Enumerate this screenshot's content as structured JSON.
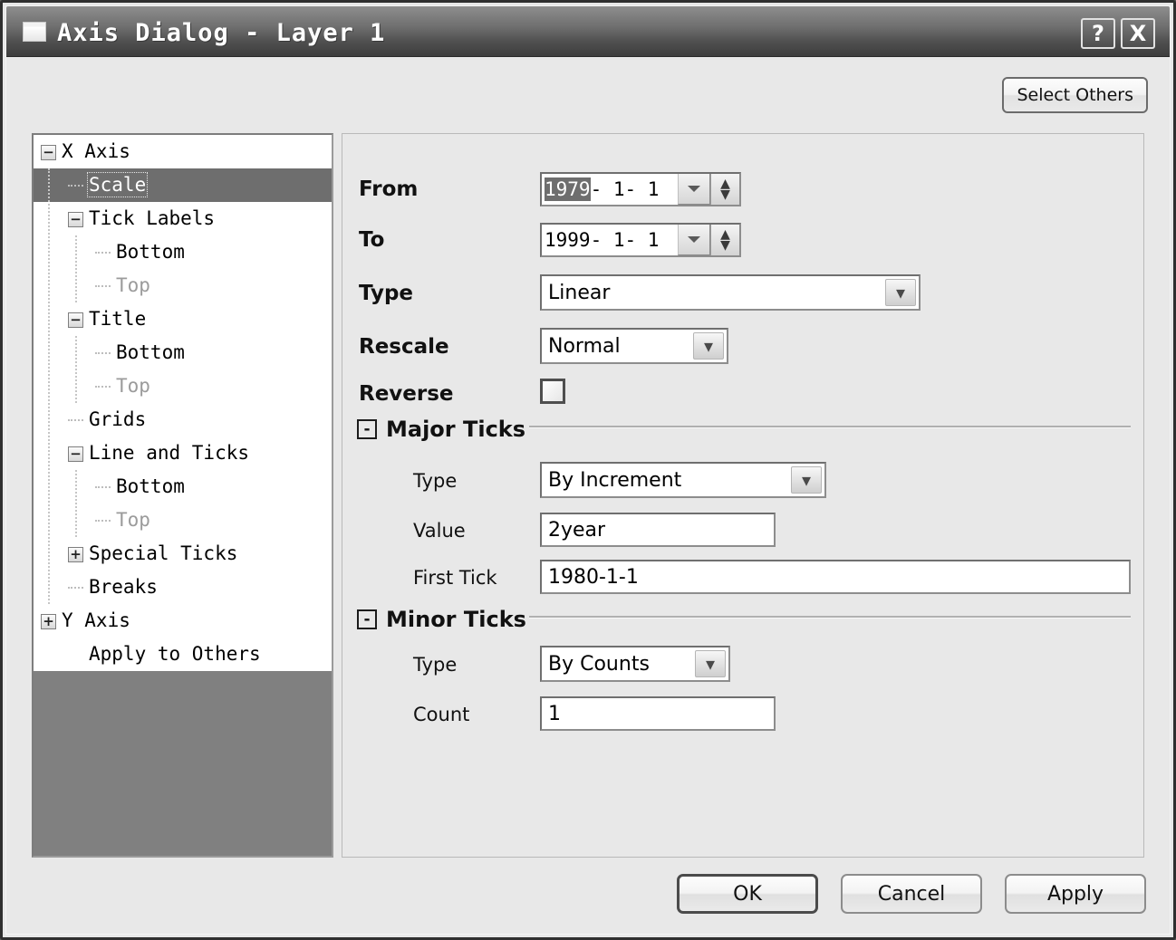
{
  "window": {
    "title": "Axis Dialog - Layer 1",
    "icon": "window-icon",
    "help_label": "?",
    "close_label": "X"
  },
  "toolbar": {
    "select_others_label": "Select Others"
  },
  "tree": {
    "items": [
      {
        "label": "X Axis",
        "depth": 0,
        "expander": "minus",
        "state": "normal"
      },
      {
        "label": "Scale",
        "depth": 1,
        "expander": "leaf",
        "state": "selected"
      },
      {
        "label": "Tick Labels",
        "depth": 1,
        "expander": "minus",
        "state": "normal"
      },
      {
        "label": "Bottom",
        "depth": 2,
        "expander": "leaf",
        "state": "normal"
      },
      {
        "label": "Top",
        "depth": 2,
        "expander": "leaf",
        "state": "dim"
      },
      {
        "label": "Title",
        "depth": 1,
        "expander": "minus",
        "state": "normal"
      },
      {
        "label": "Bottom",
        "depth": 2,
        "expander": "leaf",
        "state": "normal"
      },
      {
        "label": "Top",
        "depth": 2,
        "expander": "leaf",
        "state": "dim"
      },
      {
        "label": "Grids",
        "depth": 1,
        "expander": "leaf",
        "state": "normal"
      },
      {
        "label": "Line and Ticks",
        "depth": 1,
        "expander": "minus",
        "state": "normal"
      },
      {
        "label": "Bottom",
        "depth": 2,
        "expander": "leaf",
        "state": "normal"
      },
      {
        "label": "Top",
        "depth": 2,
        "expander": "leaf",
        "state": "dim"
      },
      {
        "label": "Special Ticks",
        "depth": 1,
        "expander": "plus",
        "state": "normal"
      },
      {
        "label": "Breaks",
        "depth": 1,
        "expander": "leaf",
        "state": "normal"
      },
      {
        "label": "Y Axis",
        "depth": 0,
        "expander": "plus",
        "state": "normal"
      },
      {
        "label": "Apply to Others",
        "depth": 1,
        "expander": "none",
        "state": "normal"
      }
    ]
  },
  "scale": {
    "from": {
      "label": "From",
      "selected_part": "1979",
      "rest": "- 1- 1"
    },
    "to": {
      "label": "To",
      "value": "1999- 1- 1"
    },
    "type": {
      "label": "Type",
      "value": "Linear"
    },
    "rescale": {
      "label": "Rescale",
      "value": "Normal"
    },
    "reverse": {
      "label": "Reverse",
      "checked": false
    }
  },
  "major_ticks": {
    "title": "Major Ticks",
    "collapse": "-",
    "type_label": "Type",
    "type_value": "By Increment",
    "value_label": "Value",
    "value_value": "2year",
    "first_tick_label": "First Tick",
    "first_tick_value": "1980-1-1"
  },
  "minor_ticks": {
    "title": "Minor Ticks",
    "collapse": "-",
    "type_label": "Type",
    "type_value": "By Counts",
    "count_label": "Count",
    "count_value": "1"
  },
  "buttons": {
    "ok": "OK",
    "cancel": "Cancel",
    "apply": "Apply"
  },
  "colors": {
    "dialog_bg": "#e8e8e8",
    "titlebar_dark": "#3d3d3d",
    "selection": "#6e6e6e",
    "tree_filler": "#808080",
    "field_bg": "#ffffff"
  }
}
